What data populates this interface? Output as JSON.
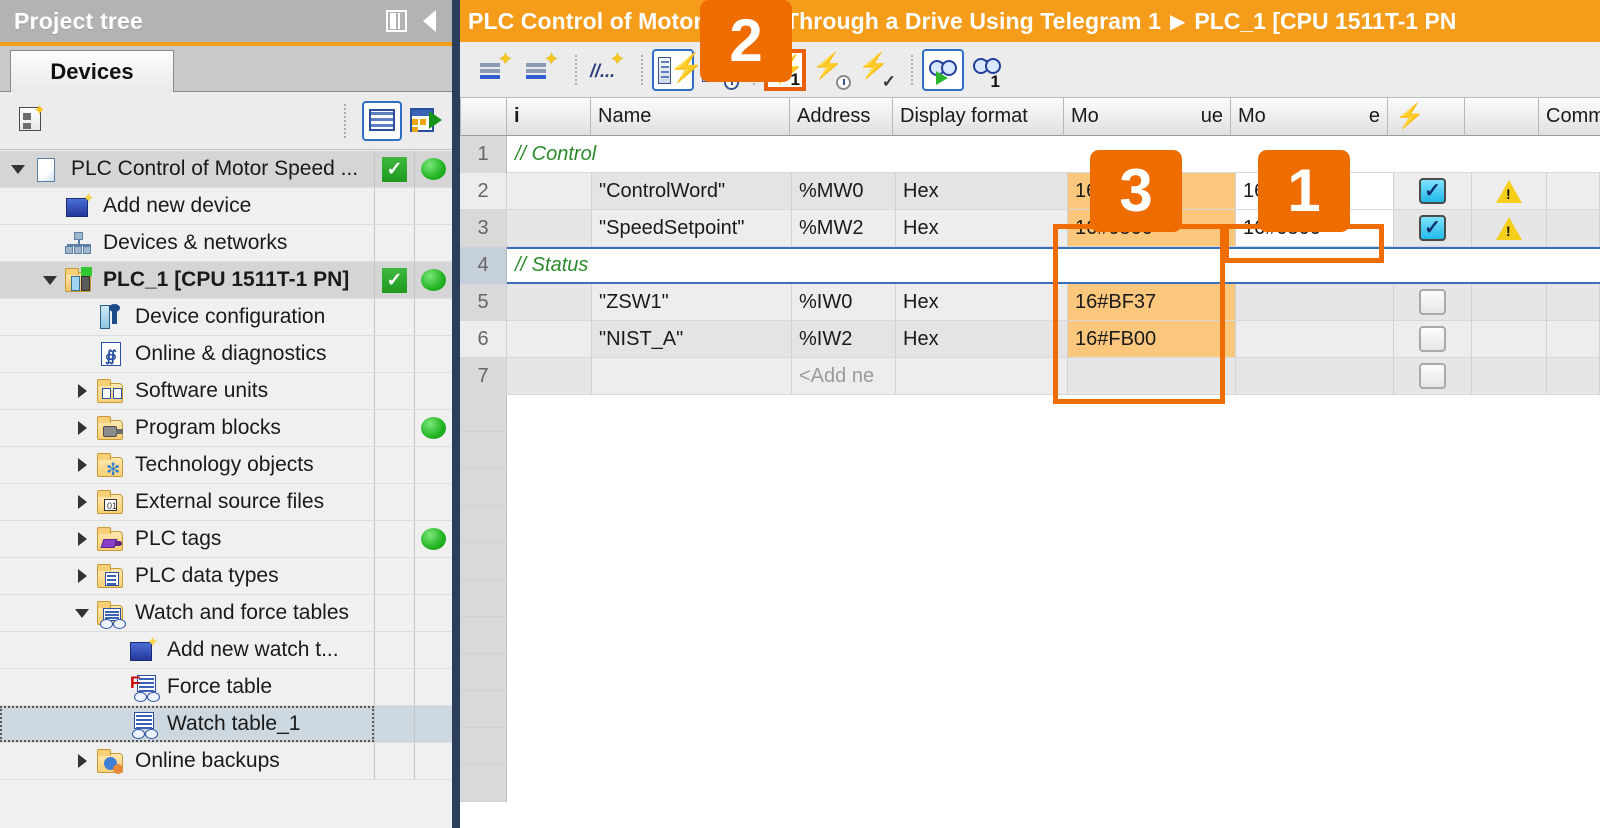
{
  "project_tree": {
    "title": "Project tree",
    "dock_icon": "dock-panel-icon",
    "collapse_icon": "collapse-left-icon",
    "tab_label": "Devices",
    "toolbar": {
      "left_icon": "device-overview-icon",
      "right_icons": [
        "table-view-icon",
        "export-table-icon"
      ]
    },
    "items": [
      {
        "label": "PLC Control of Motor Speed ...",
        "icon": "project-document-icon",
        "indent": 0,
        "expander": "down",
        "selected": true,
        "check": true,
        "dot": true,
        "bold": false
      },
      {
        "label": "Add new device",
        "icon": "add-new-device-icon",
        "indent": 1,
        "expander": "none",
        "selected": false,
        "check": false,
        "dot": false,
        "bold": false
      },
      {
        "label": "Devices & networks",
        "icon": "devices-networks-icon",
        "indent": 1,
        "expander": "none",
        "selected": false,
        "check": false,
        "dot": false,
        "bold": false
      },
      {
        "label": "PLC_1 [CPU 1511T-1 PN]",
        "icon": "plc-device-icon",
        "indent": 1,
        "expander": "down",
        "selected": true,
        "check": true,
        "dot": true,
        "bold": true
      },
      {
        "label": "Device configuration",
        "icon": "device-config-icon",
        "indent": 2,
        "expander": "none",
        "selected": false,
        "check": false,
        "dot": false,
        "bold": false
      },
      {
        "label": "Online & diagnostics",
        "icon": "online-diagnostics-icon",
        "indent": 2,
        "expander": "none",
        "selected": false,
        "check": false,
        "dot": false,
        "bold": false
      },
      {
        "label": "Software units",
        "icon": "software-units-icon",
        "indent": 2,
        "expander": "right",
        "selected": false,
        "check": false,
        "dot": false,
        "bold": false
      },
      {
        "label": "Program blocks",
        "icon": "program-blocks-icon",
        "indent": 2,
        "expander": "right",
        "selected": false,
        "check": false,
        "dot": true,
        "bold": false
      },
      {
        "label": "Technology objects",
        "icon": "technology-objects-icon",
        "indent": 2,
        "expander": "right",
        "selected": false,
        "check": false,
        "dot": false,
        "bold": false
      },
      {
        "label": "External source files",
        "icon": "external-source-icon",
        "indent": 2,
        "expander": "right",
        "selected": false,
        "check": false,
        "dot": false,
        "bold": false
      },
      {
        "label": "PLC tags",
        "icon": "plc-tags-icon",
        "indent": 2,
        "expander": "right",
        "selected": false,
        "check": false,
        "dot": true,
        "bold": false
      },
      {
        "label": "PLC data types",
        "icon": "plc-data-types-icon",
        "indent": 2,
        "expander": "right",
        "selected": false,
        "check": false,
        "dot": false,
        "bold": false
      },
      {
        "label": "Watch and force tables",
        "icon": "watch-force-tables-icon",
        "indent": 2,
        "expander": "down",
        "selected": false,
        "check": false,
        "dot": false,
        "bold": false
      },
      {
        "label": "Add new watch t...",
        "icon": "add-new-watch-table-icon",
        "indent": 3,
        "expander": "none",
        "selected": false,
        "check": false,
        "dot": false,
        "bold": false
      },
      {
        "label": "Force table",
        "icon": "force-table-icon",
        "indent": 3,
        "expander": "none",
        "selected": false,
        "check": false,
        "dot": false,
        "bold": false
      },
      {
        "label": "Watch table_1",
        "icon": "watch-table-icon",
        "indent": 3,
        "expander": "none",
        "selected": false,
        "check": false,
        "dot": false,
        "bold": false,
        "focused": true
      },
      {
        "label": "Online backups",
        "icon": "online-backups-icon",
        "indent": 2,
        "expander": "right",
        "selected": false,
        "check": false,
        "dot": false,
        "bold": false
      }
    ]
  },
  "editor": {
    "breadcrumb": [
      "PLC Control of Motor Speed Through a Drive Using Telegram 1",
      "PLC_1 [CPU 1511T-1 PN"
    ],
    "toolbar_buttons": [
      {
        "name": "insert-row-before-icon",
        "state": "normal"
      },
      {
        "name": "insert-row-after-icon",
        "state": "normal"
      },
      {
        "name": "insert-comment-row-icon",
        "state": "normal"
      },
      {
        "name": "monitor-all-icon",
        "state": "outlined-blue"
      },
      {
        "name": "monitor-all-once-icon",
        "state": "normal"
      },
      {
        "name": "modify-now-icon",
        "state": "outlined-orange"
      },
      {
        "name": "modify-with-trigger-icon",
        "state": "normal"
      },
      {
        "name": "enable-peripheral-outputs-icon",
        "state": "normal"
      },
      {
        "name": "monitor-glasses-icon",
        "state": "outlined-blue"
      },
      {
        "name": "monitor-glasses-once-icon",
        "state": "normal"
      }
    ]
  },
  "table": {
    "columns": [
      {
        "key": "num",
        "label": ""
      },
      {
        "key": "info",
        "label": "i"
      },
      {
        "key": "name",
        "label": "Name"
      },
      {
        "key": "addr",
        "label": "Address"
      },
      {
        "key": "fmt",
        "label": "Display format"
      },
      {
        "key": "mon",
        "label": "Monitor value"
      },
      {
        "key": "mod",
        "label": "Modify value"
      },
      {
        "key": "bolt",
        "label": "bolt-icon"
      },
      {
        "key": "warn",
        "label": ""
      },
      {
        "key": "comm",
        "label": "Comment"
      }
    ],
    "header_short": {
      "mon": "Mo",
      "mon_tail": "ue",
      "mod": "Mo",
      "mod_tail": "e",
      "comment": "Comm"
    },
    "rows": [
      {
        "num": "1",
        "type": "comment",
        "text": "// Control",
        "selected": false
      },
      {
        "num": "2",
        "type": "data",
        "name": "\"ControlWord\"",
        "addr": "%MW0",
        "fmt": "Hex",
        "mon": "16#0C7F",
        "mod": "16#0C7F",
        "check": "on",
        "warn": true
      },
      {
        "num": "3",
        "type": "data",
        "name": "\"SpeedSetpoint\"",
        "addr": "%MW2",
        "fmt": "Hex",
        "mon": "16#0500",
        "mod": "16#0500",
        "check": "on",
        "warn": true
      },
      {
        "num": "4",
        "type": "comment",
        "text": "// Status",
        "selected": true
      },
      {
        "num": "5",
        "type": "data",
        "name": "\"ZSW1\"",
        "addr": "%IW0",
        "fmt": "Hex",
        "mon": "16#BF37",
        "mod": "",
        "check": "off",
        "warn": false
      },
      {
        "num": "6",
        "type": "data",
        "name": "\"NIST_A\"",
        "addr": "%IW2",
        "fmt": "Hex",
        "mon": "16#FB00",
        "mod": "",
        "check": "off",
        "warn": false
      },
      {
        "num": "7",
        "type": "addnew",
        "addr": "<Add ne",
        "check": "off"
      }
    ],
    "blank_row_count": 11
  },
  "callouts": [
    {
      "label": "1",
      "name": "callout-1-modify-value"
    },
    {
      "label": "2",
      "name": "callout-2-modify-now-button"
    },
    {
      "label": "3",
      "name": "callout-3-monitor-value-column"
    }
  ],
  "colors": {
    "accent_orange": "#f59c1a",
    "callout_orange": "#ef6c00",
    "monitor_value_bg": "#fbc77d",
    "title_gray": "#b3b3b3",
    "status_green": "#21b321"
  }
}
